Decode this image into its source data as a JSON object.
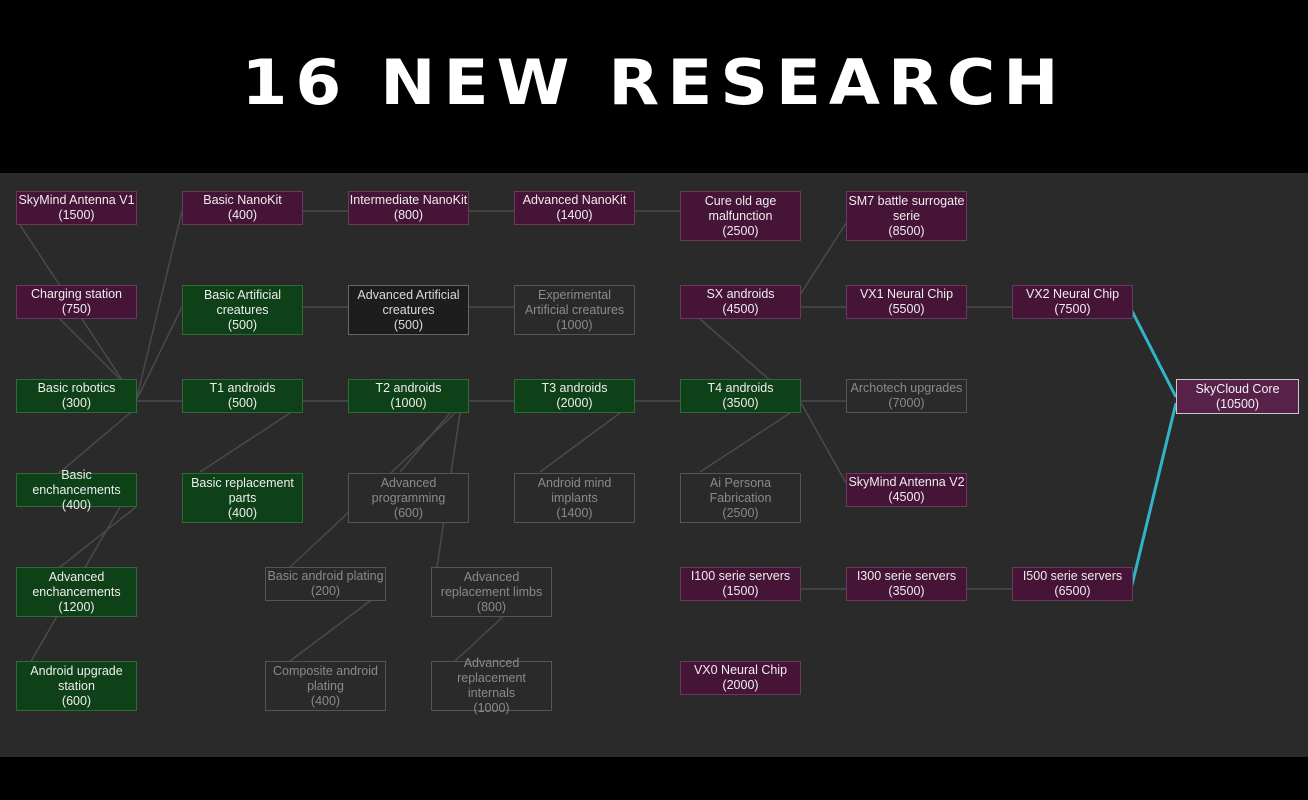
{
  "banner": {
    "title": "16 NEW RESEARCH"
  },
  "colors": {
    "available": "#461436",
    "completed": "#0e4118",
    "in_progress": "#1d1d1d",
    "locked": "#2a2a2a",
    "highlight_link": "#2fb4c8"
  },
  "nodes": {
    "skymind_antenna_v1": {
      "name": "SkyMind Antenna V1",
      "cost": "(1500)",
      "state": "available"
    },
    "charging_station": {
      "name": "Charging station",
      "cost": "(750)",
      "state": "available"
    },
    "basic_robotics": {
      "name": "Basic robotics",
      "cost": "(300)",
      "state": "completed"
    },
    "basic_enchancements": {
      "name": "Basic enchancements",
      "cost": "(400)",
      "state": "completed"
    },
    "advanced_enchancements": {
      "name": "Advanced enchancements",
      "cost": "(1200)",
      "state": "completed"
    },
    "android_upgrade_station": {
      "name": "Android upgrade station",
      "cost": "(600)",
      "state": "completed"
    },
    "basic_nanokit": {
      "name": "Basic NanoKit",
      "cost": "(400)",
      "state": "available"
    },
    "basic_artificial_creatures": {
      "name": "Basic Artificial creatures",
      "cost": "(500)",
      "state": "completed"
    },
    "t1_androids": {
      "name": "T1 androids",
      "cost": "(500)",
      "state": "completed"
    },
    "basic_replacement_parts": {
      "name": "Basic replacement parts",
      "cost": "(400)",
      "state": "completed"
    },
    "intermediate_nanokit": {
      "name": "Intermediate NanoKit",
      "cost": "(800)",
      "state": "available"
    },
    "advanced_artificial_creatures": {
      "name": "Advanced Artificial creatures",
      "cost": "(500)",
      "state": "in_progress"
    },
    "t2_androids": {
      "name": "T2 androids",
      "cost": "(1000)",
      "state": "completed"
    },
    "advanced_programming": {
      "name": "Advanced programming",
      "cost": "(600)",
      "state": "locked"
    },
    "basic_android_plating": {
      "name": "Basic android plating",
      "cost": "(200)",
      "state": "locked"
    },
    "composite_android_plating": {
      "name": "Composite android plating",
      "cost": "(400)",
      "state": "locked"
    },
    "advanced_replacement_limbs": {
      "name": "Advanced replacement limbs",
      "cost": "(800)",
      "state": "locked"
    },
    "advanced_replacement_internals": {
      "name": "Advanced replacement internals",
      "cost": "(1000)",
      "state": "locked"
    },
    "advanced_nanokit": {
      "name": "Advanced NanoKit",
      "cost": "(1400)",
      "state": "available"
    },
    "experimental_artificial_creatures": {
      "name": "Experimental Artificial creatures",
      "cost": "(1000)",
      "state": "locked"
    },
    "t3_androids": {
      "name": "T3 androids",
      "cost": "(2000)",
      "state": "completed"
    },
    "android_mind_implants": {
      "name": "Android mind implants",
      "cost": "(1400)",
      "state": "locked"
    },
    "cure_old_age": {
      "name": "Cure old age malfunction",
      "cost": "(2500)",
      "state": "available"
    },
    "sx_androids": {
      "name": "SX androids",
      "cost": "(4500)",
      "state": "available"
    },
    "t4_androids": {
      "name": "T4 androids",
      "cost": "(3500)",
      "state": "completed"
    },
    "ai_persona_fabrication": {
      "name": "Ai Persona Fabrication",
      "cost": "(2500)",
      "state": "locked"
    },
    "i100_serie_servers": {
      "name": "I100 serie servers",
      "cost": "(1500)",
      "state": "available"
    },
    "vx0_neural_chip": {
      "name": "VX0 Neural Chip",
      "cost": "(2000)",
      "state": "available"
    },
    "sm7_battle_surrogate": {
      "name": "SM7 battle surrogate serie",
      "cost": "(8500)",
      "state": "available"
    },
    "vx1_neural_chip": {
      "name": "VX1 Neural Chip",
      "cost": "(5500)",
      "state": "available"
    },
    "archotech_upgrades": {
      "name": "Archotech upgrades",
      "cost": "(7000)",
      "state": "locked"
    },
    "skymind_antenna_v2": {
      "name": "SkyMind Antenna V2",
      "cost": "(4500)",
      "state": "available"
    },
    "i300_serie_servers": {
      "name": "I300 serie servers",
      "cost": "(3500)",
      "state": "available"
    },
    "vx2_neural_chip": {
      "name": "VX2 Neural Chip",
      "cost": "(7500)",
      "state": "available"
    },
    "i500_serie_servers": {
      "name": "I500 serie servers",
      "cost": "(6500)",
      "state": "available"
    },
    "skycloud_core": {
      "name": "SkyCloud Core",
      "cost": "(10500)",
      "state": "selected"
    }
  }
}
